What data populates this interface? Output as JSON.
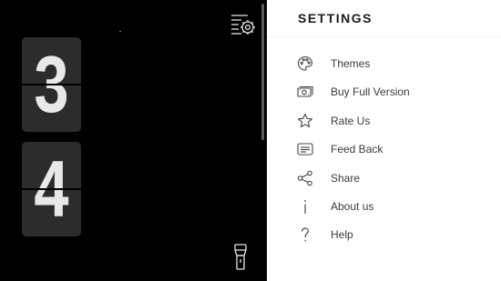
{
  "clock": {
    "hours": "3",
    "minutes": "4"
  },
  "settings": {
    "title": "SETTINGS",
    "items": [
      {
        "label": "Themes",
        "icon": "palette-icon"
      },
      {
        "label": "Buy Full Version",
        "icon": "money-icon"
      },
      {
        "label": "Rate Us",
        "icon": "star-icon"
      },
      {
        "label": "Feed Back",
        "icon": "message-icon"
      },
      {
        "label": "Share",
        "icon": "share-icon"
      },
      {
        "label": "About us",
        "icon": "info-icon"
      },
      {
        "label": "Help",
        "icon": "question-icon"
      }
    ]
  },
  "colors": {
    "background": "#000000",
    "card": "#2c2c2c",
    "digit": "#e8e8e8",
    "panel": "#ffffff",
    "text": "#3a3a3a"
  }
}
